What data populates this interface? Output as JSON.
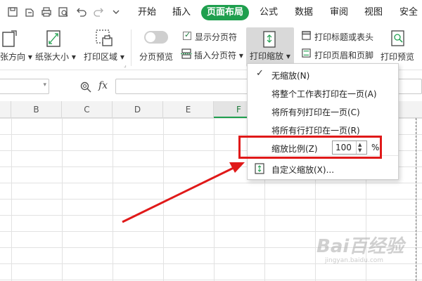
{
  "menu_tabs": [
    "开始",
    "插入",
    "页面布局",
    "公式",
    "数据",
    "审阅",
    "视图",
    "安全"
  ],
  "active_tab": "页面布局",
  "quick_access_icons": [
    "save-icon",
    "export-icon",
    "print-icon",
    "print-preview-icon",
    "undo-icon",
    "redo-icon",
    "dropdown-icon"
  ],
  "ribbon": {
    "orientation_label": "纸张方向",
    "paper_size_label": "纸张大小",
    "print_area_label": "打印区域",
    "page_break_preview_label": "分页预览",
    "show_page_breaks_label": "显示分页符",
    "show_page_breaks_checked": true,
    "insert_page_break_label": "插入分页符",
    "print_scaling_label": "打印缩放",
    "print_titles_label": "打印标题或表头",
    "header_footer_label": "打印页眉和页脚",
    "print_preview_label": "打印预览"
  },
  "formula_bar": {
    "fx_label": "fx"
  },
  "columns": [
    "B",
    "C",
    "D",
    "E",
    "F"
  ],
  "selected_column": "F",
  "scaling_menu": {
    "items": [
      {
        "label": "无缩放(N)",
        "checked": true
      },
      {
        "label": "将整个工作表打印在一页(A)",
        "checked": false
      },
      {
        "label": "将所有列打印在一页(C)",
        "checked": false
      },
      {
        "label": "将所有行打印在一页(R)",
        "checked": false
      }
    ],
    "zoom_label": "缩放比例(Z)",
    "zoom_value": "100",
    "zoom_unit": "%",
    "custom_label": "自定义缩放(X)..."
  },
  "watermark": {
    "brand": "Bai百经验",
    "sub": "jingyan.baidu.com"
  },
  "colors": {
    "accent": "#1f9f4e",
    "highlight": "#e01919"
  }
}
